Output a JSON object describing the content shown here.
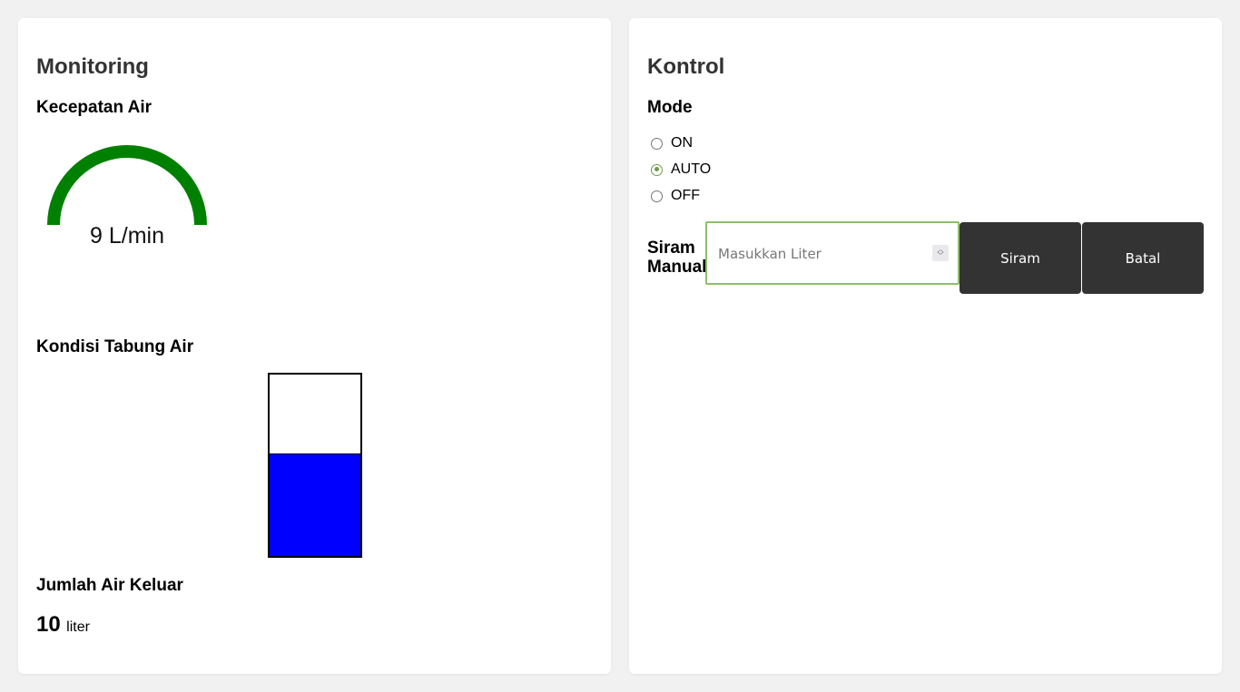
{
  "monitoring": {
    "title": "Monitoring",
    "flow_label": "Kecepatan Air",
    "flow_value": 9,
    "flow_display": "9 L/min",
    "gauge_color": "#008000",
    "tank_label": "Kondisi Tabung Air",
    "tank_level_fraction": 0.56,
    "tank_fill_color": "#0000ff",
    "water_out_label": "Jumlah Air Keluar",
    "water_out_value": "10",
    "water_out_unit": "liter"
  },
  "kontrol": {
    "title": "Kontrol",
    "mode_label": "Mode",
    "mode_options": [
      "ON",
      "AUTO",
      "OFF"
    ],
    "mode_selected": "AUTO",
    "manual_label_line1": "Siram",
    "manual_label_line2": "Manual",
    "liter_input_placeholder": "Masukkan Liter",
    "liter_input_value": "",
    "siram_button": "Siram",
    "batal_button": "Batal",
    "accent_color": "#6f9a4a"
  }
}
